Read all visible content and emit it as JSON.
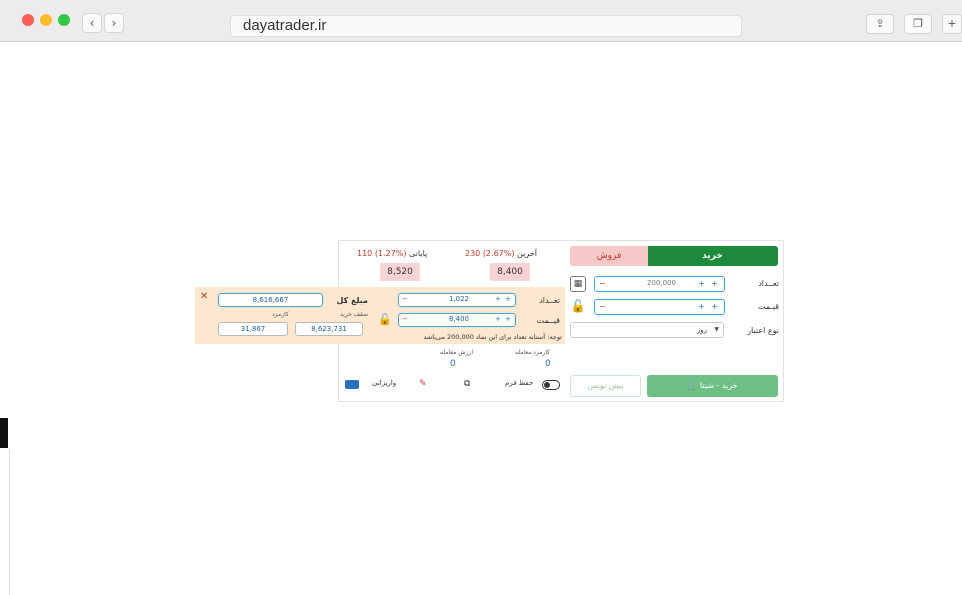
{
  "browser": {
    "url": "dayatrader.ir",
    "back_icon": "chevron-left-icon",
    "forward_icon": "chevron-right-icon",
    "share_icon": "share-icon",
    "tabs_icon": "tabs-icon",
    "traffic_colors": [
      "#fc5f57",
      "#fdbc2e",
      "#33c748"
    ]
  },
  "order": {
    "tab_buy": "خرید",
    "tab_sell": "فروش",
    "qty_label": "تعــداد",
    "price_label": "قیـمت",
    "validity_label": "نوع اعتبار",
    "qty_value": "200,000",
    "price_value": "",
    "validity_value": "روز",
    "buy_button": "خرید - شیتا",
    "draft_button": "پیش نویس",
    "minus": "−",
    "plus": "+ +"
  },
  "summary": {
    "last_label": "آخرین",
    "last_change": "230 (2.67%)",
    "last_price": "8,400",
    "close_label": "پایانی",
    "close_change": "110 (1.27%)",
    "close_price": "8,520"
  },
  "calc": {
    "qty_label": "تعــداد",
    "price_label": "قیــمت",
    "qty_value": "1,022",
    "price_value": "8,400",
    "total_label": "مبلغ کل",
    "total_value": "8,616,667",
    "cap_label": "سقف خرید",
    "cap_value": "8,623,731",
    "fee_label": "کارمزد",
    "fee_value": "31,867",
    "note": "توجه: آستانه تعداد برای این نماد 200,000 می‌باشد",
    "trade_fee_label": "کارمزد معامله",
    "trade_fee_value": "0",
    "trade_value_label": "ارزش معامله",
    "trade_value_value": "0",
    "close_icon": "close-icon",
    "lock_icon": "unlock-icon"
  },
  "footer": {
    "save_form": "حفظ فرم",
    "deposit": "واریزانی",
    "toggle_icon": "toggle-icon",
    "copy_icon": "copy-icon",
    "eraser_icon": "eraser-icon",
    "card_icon": "card-icon"
  }
}
